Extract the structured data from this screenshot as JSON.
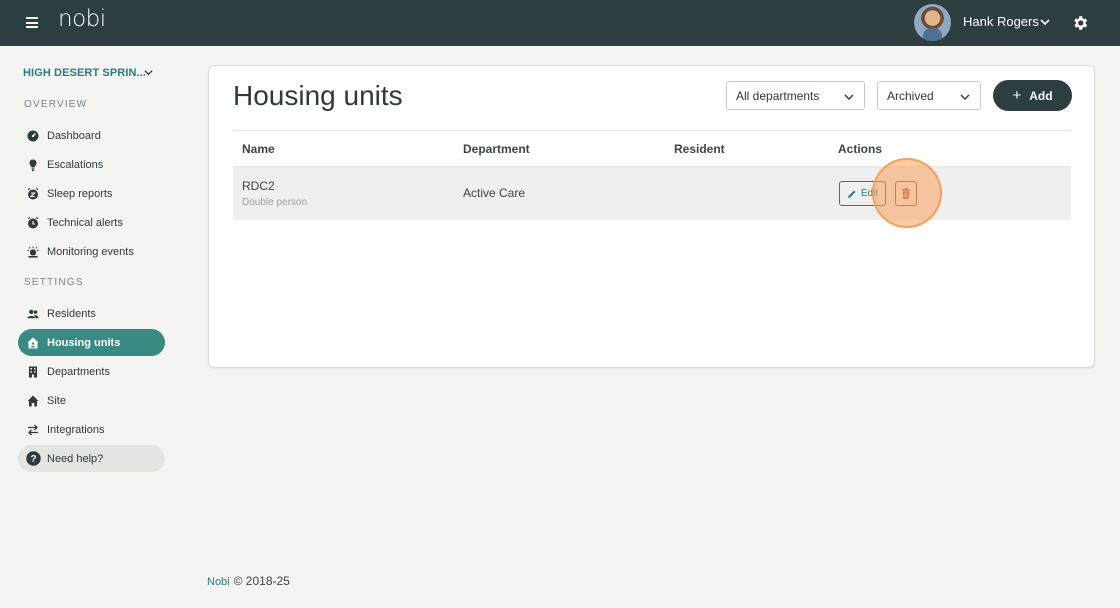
{
  "app": {
    "logo": "nobi"
  },
  "header": {
    "user_name": "Hank Rogers",
    "icons": [
      "menu-icon",
      "avatar",
      "chevron-down-icon",
      "gear-icon"
    ]
  },
  "sidebar": {
    "site_name": "HIGH DESERT SPRIN...",
    "overview_label": "OVERVIEW",
    "overview_items": [
      {
        "label": "Dashboard",
        "icon": "dashboard-icon"
      },
      {
        "label": "Escalations",
        "icon": "escalations-icon"
      },
      {
        "label": "Sleep reports",
        "icon": "sleep-icon"
      },
      {
        "label": "Technical alerts",
        "icon": "alarm-icon"
      },
      {
        "label": "Monitoring events",
        "icon": "monitoring-icon"
      }
    ],
    "settings_label": "SETTINGS",
    "settings_items": [
      {
        "label": "Residents",
        "icon": "people-icon"
      },
      {
        "label": "Housing units",
        "icon": "housing-icon",
        "active": true
      },
      {
        "label": "Departments",
        "icon": "building-icon"
      },
      {
        "label": "Site",
        "icon": "home-icon"
      },
      {
        "label": "Integrations",
        "icon": "swap-icon"
      }
    ],
    "help_label": "Need help?"
  },
  "main": {
    "title": "Housing units",
    "department_filter": "All departments",
    "status_filter": "Archived",
    "add_label": "Add",
    "columns": [
      "Name",
      "Department",
      "Resident",
      "Actions"
    ],
    "rows": [
      {
        "name": "RDC2",
        "type": "Double person",
        "department": "Active Care",
        "resident": "",
        "edit_label": "Edit"
      }
    ]
  },
  "footer": {
    "brand": "Nobi",
    "copyright": "© 2018-25"
  },
  "colors": {
    "topbar": "#2c3e40",
    "accent": "#3a8a84",
    "danger": "#b24b3a",
    "click_highlight": "#f5a05a"
  }
}
